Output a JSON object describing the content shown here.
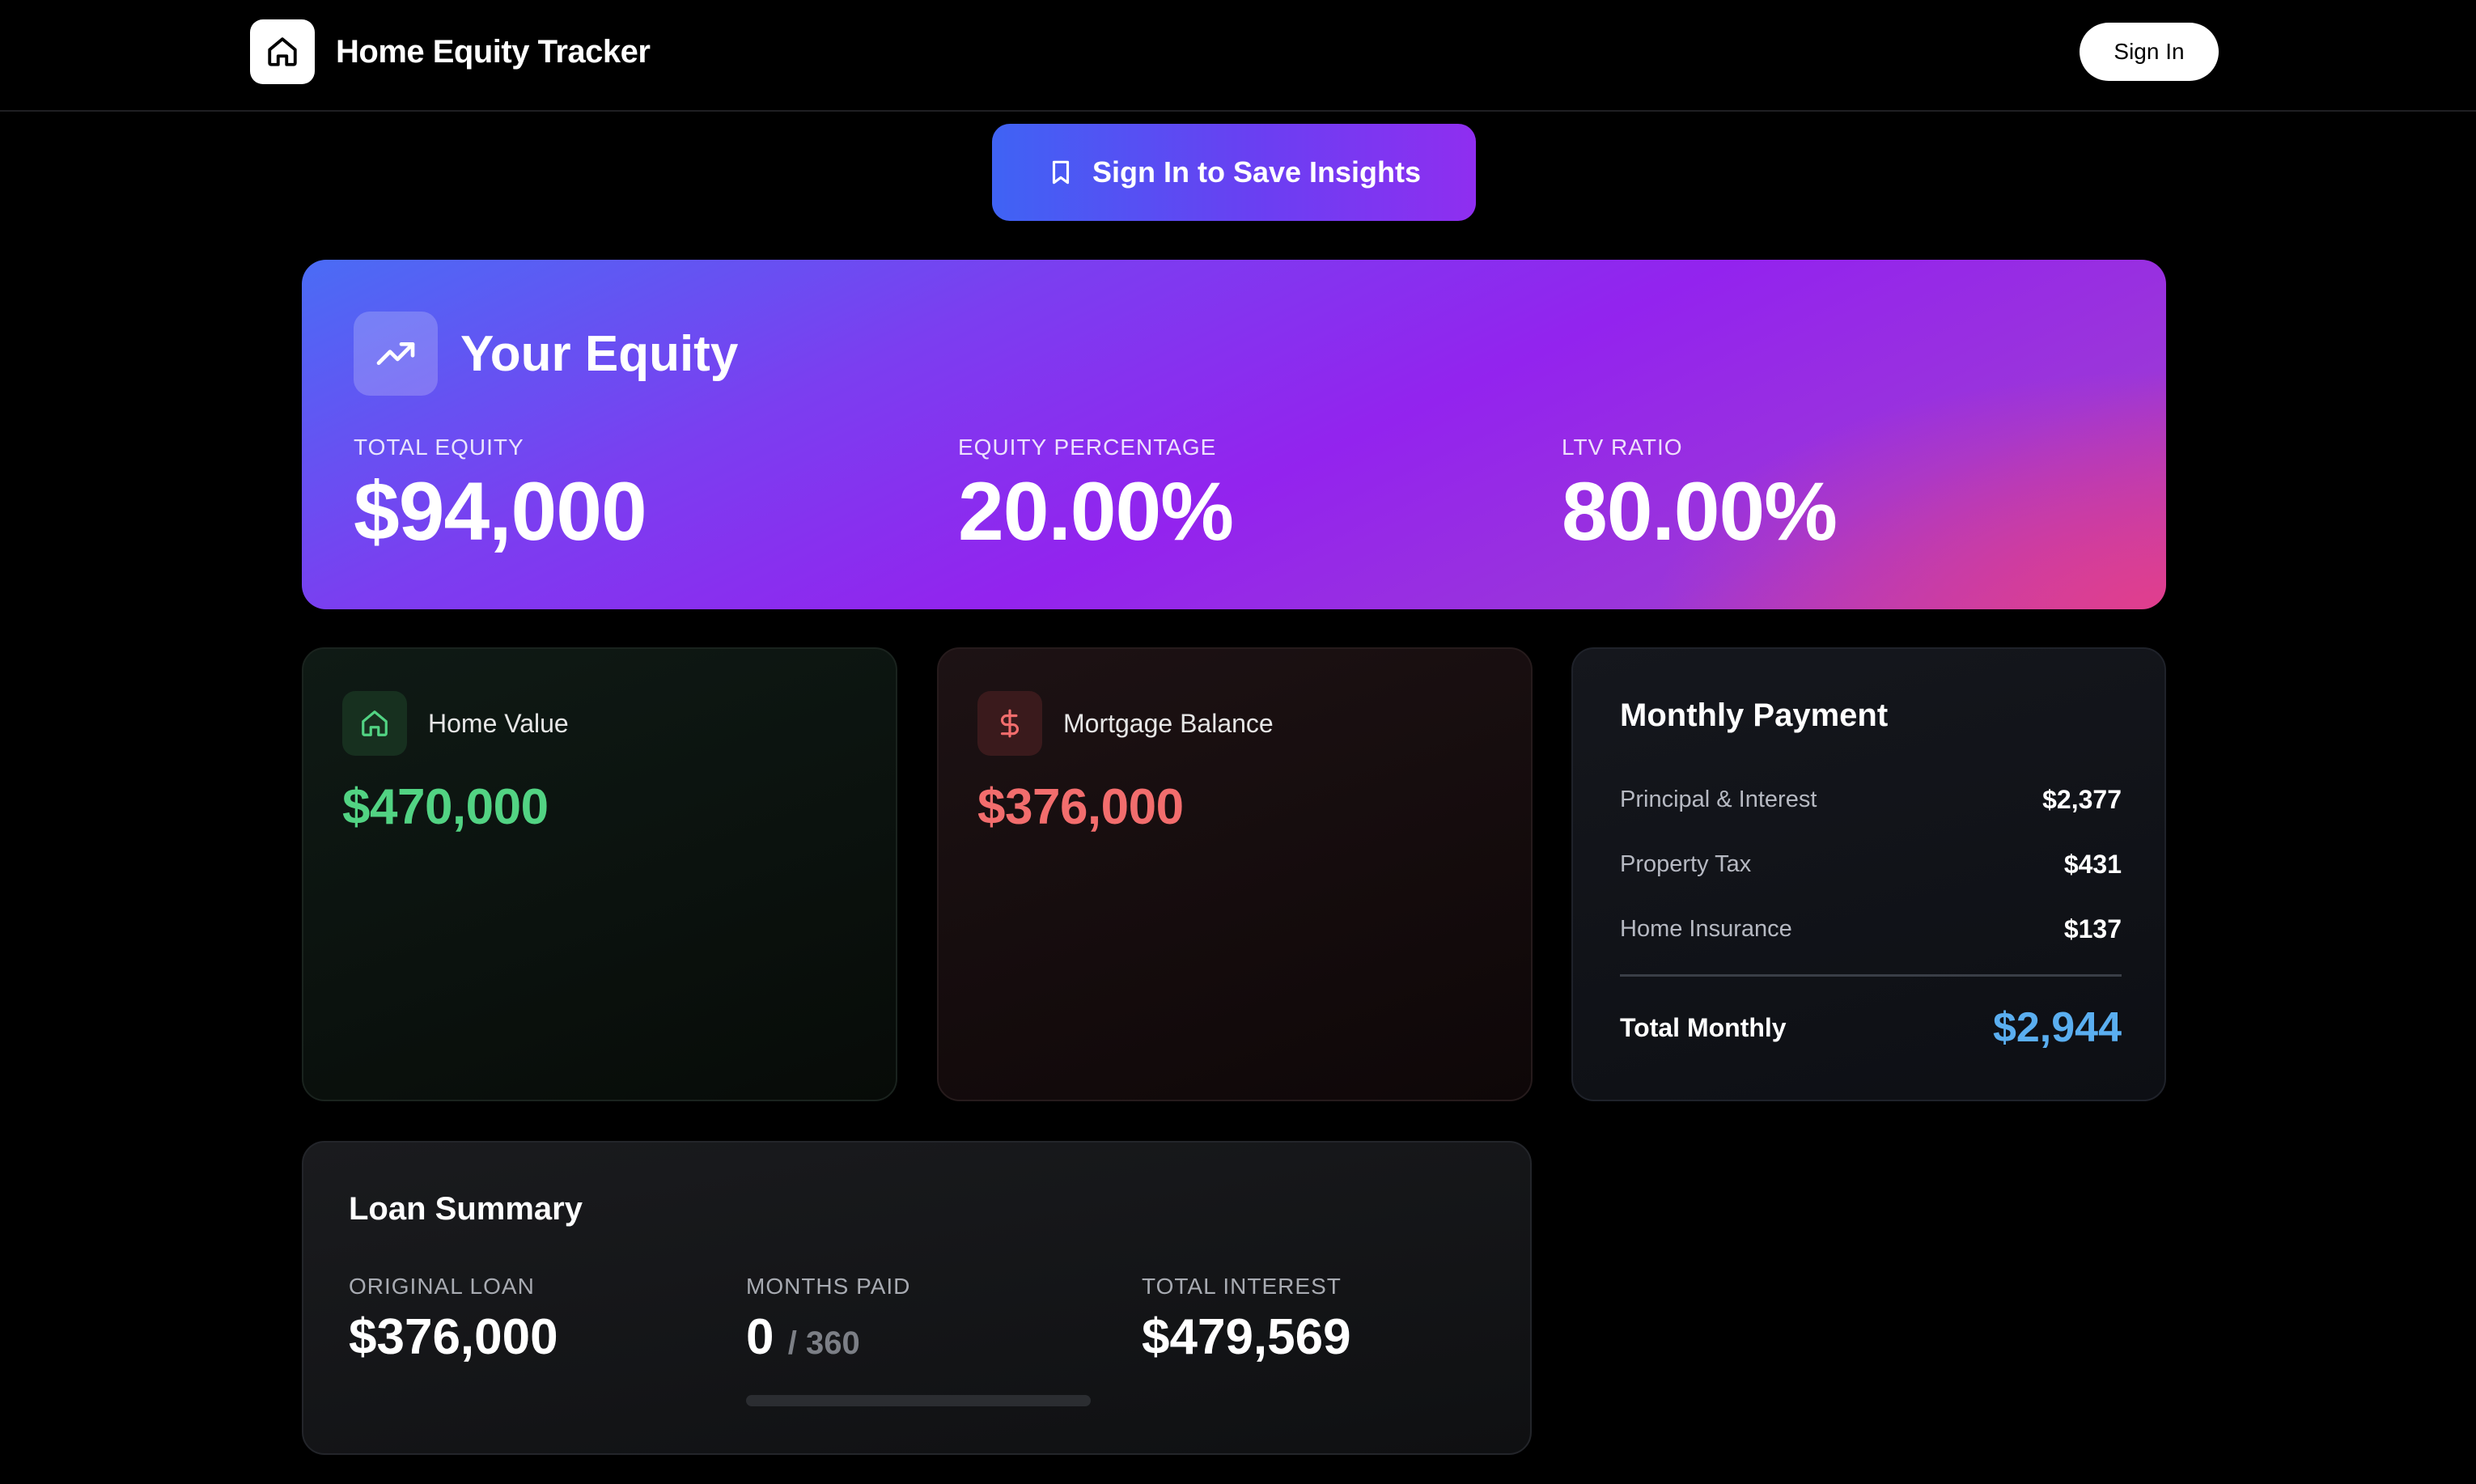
{
  "header": {
    "app_title": "Home Equity Tracker",
    "signin_label": "Sign In"
  },
  "save_insights": {
    "label": "Sign In to Save Insights"
  },
  "equity": {
    "title": "Your Equity",
    "metrics": [
      {
        "label": "TOTAL EQUITY",
        "value": "$94,000"
      },
      {
        "label": "EQUITY PERCENTAGE",
        "value": "20.00%"
      },
      {
        "label": "LTV RATIO",
        "value": "80.00%"
      }
    ]
  },
  "home_value": {
    "label": "Home Value",
    "value": "$470,000"
  },
  "mortgage_balance": {
    "label": "Mortgage Balance",
    "value": "$376,000"
  },
  "monthly_payment": {
    "title": "Monthly Payment",
    "rows": [
      {
        "name": "Principal & Interest",
        "amount": "$2,377"
      },
      {
        "name": "Property Tax",
        "amount": "$431"
      },
      {
        "name": "Home Insurance",
        "amount": "$137"
      }
    ],
    "total_label": "Total Monthly",
    "total_amount": "$2,944"
  },
  "loan_summary": {
    "title": "Loan Summary",
    "original_loan_label": "ORIGINAL LOAN",
    "original_loan_value": "$376,000",
    "months_paid_label": "MONTHS PAID",
    "months_paid_value": "0",
    "months_total": "/ 360",
    "months_progress": 0,
    "total_interest_label": "TOTAL INTEREST",
    "total_interest_value": "$479,569"
  },
  "icons": {
    "brand": "home-icon",
    "save": "bookmark-icon",
    "equity": "trending-up-icon",
    "home_value": "home-icon",
    "mortgage": "dollar-icon"
  },
  "colors": {
    "accent_blue": "#5aaef0",
    "home_green": "#52d383",
    "mortgage_red": "#f26d6d",
    "gradient_start": "#4a6cf5",
    "gradient_mid": "#9323ee",
    "gradient_end": "#e23e8c"
  }
}
